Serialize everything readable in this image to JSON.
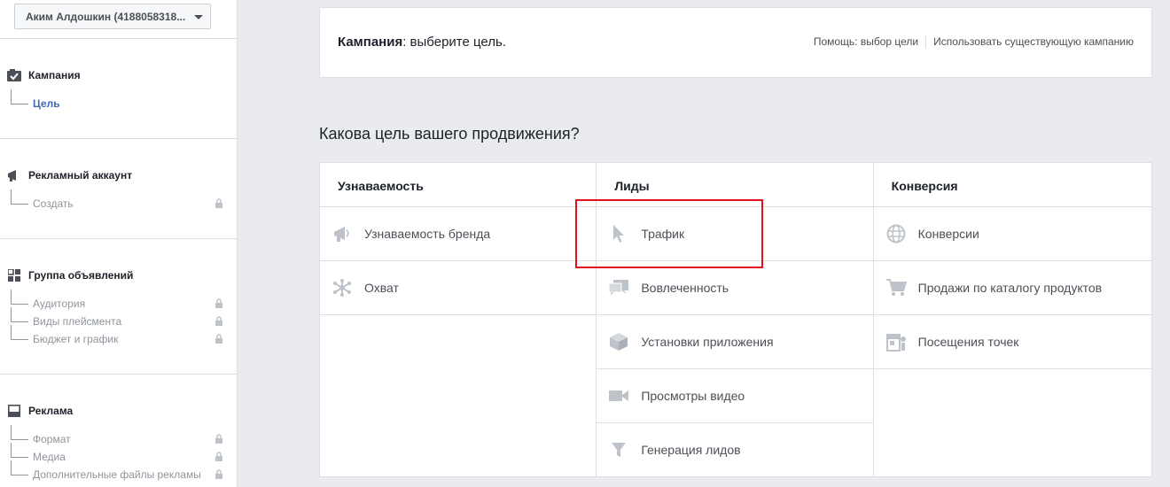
{
  "account_selector": {
    "label": "Аким Алдошкин (4188058318..."
  },
  "sidebar": {
    "sections": [
      {
        "title": "Кампания",
        "icon": "checked-box-icon",
        "items": [
          {
            "label": "Цель",
            "active": true,
            "locked": false
          }
        ]
      },
      {
        "title": "Рекламный аккаунт",
        "icon": "megaphone-icon",
        "items": [
          {
            "label": "Создать",
            "locked": true
          }
        ]
      },
      {
        "title": "Группа объявлений",
        "icon": "grid-icon",
        "items": [
          {
            "label": "Аудитория",
            "locked": true
          },
          {
            "label": "Виды плейсмента",
            "locked": true
          },
          {
            "label": "Бюджет и график",
            "locked": true
          }
        ]
      },
      {
        "title": "Реклама",
        "icon": "ad-frame-icon",
        "items": [
          {
            "label": "Формат",
            "locked": true
          },
          {
            "label": "Медиа",
            "locked": true
          },
          {
            "label": "Дополнительные файлы рекламы",
            "locked": true
          }
        ]
      }
    ]
  },
  "header": {
    "title_bold": "Кампания",
    "title_rest": ": выберите цель.",
    "help_link": "Помощь: выбор цели",
    "existing_link": "Использовать существующую кампанию"
  },
  "question": "Какова цель вашего продвижения?",
  "objectives": {
    "columns": [
      {
        "title": "Узнаваемость",
        "options": [
          {
            "label": "Узнаваемость бренда",
            "icon": "megaphone-icon"
          },
          {
            "label": "Охват",
            "icon": "asterisk-icon"
          }
        ]
      },
      {
        "title": "Лиды",
        "options": [
          {
            "label": "Трафик",
            "icon": "cursor-icon"
          },
          {
            "label": "Вовлеченность",
            "icon": "chat-bubbles-icon"
          },
          {
            "label": "Установки приложения",
            "icon": "box-icon"
          },
          {
            "label": "Просмотры видео",
            "icon": "video-camera-icon"
          },
          {
            "label": "Генерация лидов",
            "icon": "funnel-icon"
          }
        ]
      },
      {
        "title": "Конверсия",
        "options": [
          {
            "label": "Конверсии",
            "icon": "globe-icon"
          },
          {
            "label": "Продажи по каталогу продуктов",
            "icon": "cart-icon"
          },
          {
            "label": "Посещения точек",
            "icon": "store-icon"
          }
        ]
      }
    ]
  },
  "colors": {
    "accent": "#4267b2",
    "highlight": "#e4121b",
    "icon": "#bec3c9"
  }
}
